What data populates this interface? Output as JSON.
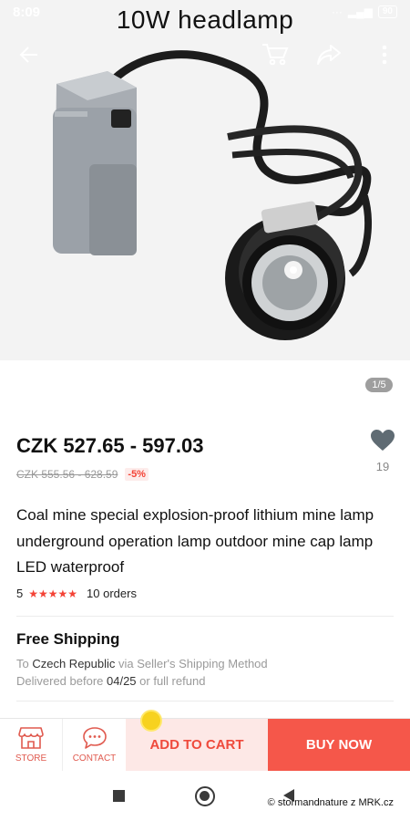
{
  "status_bar": {
    "time": "8:09",
    "battery": "90"
  },
  "image_overlay_title": "10W  headlamp",
  "nav": {
    "back_icon": "arrow-left-icon",
    "cart_icon": "cart-icon",
    "share_icon": "share-icon",
    "more_icon": "more-vertical-icon"
  },
  "image_counter": "1/5",
  "product": {
    "price": "CZK 527.65 - 597.03",
    "original_price": "CZK 555.56 - 628.59",
    "discount": "-5%",
    "wishlist_count": "19",
    "title": "Coal mine special explosion-proof lithium mine lamp underground operation lamp outdoor mine cap lamp LED waterproof",
    "rating": "5",
    "stars": "★★★★★",
    "orders": "10 orders"
  },
  "shipping": {
    "title": "Free Shipping",
    "to_prefix": "To ",
    "country": "Czech Republic",
    "method": " via Seller's Shipping Method",
    "delivery_prefix": "Delivered before ",
    "delivery_date": "04/25",
    "delivery_suffix": " or full refund"
  },
  "actions": {
    "store": "STORE",
    "contact": "CONTACT",
    "add_to_cart": "ADD TO CART",
    "buy_now": "BUY NOW"
  },
  "watermark": "© stormandnature z MRK.cz",
  "colors": {
    "accent": "#f5574a",
    "accent_light": "#fde8e6",
    "discount": "#f44336"
  }
}
